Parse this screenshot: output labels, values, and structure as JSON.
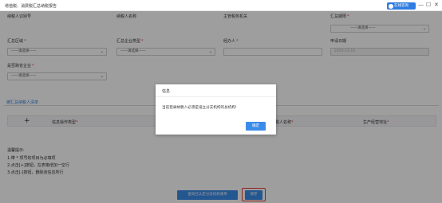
{
  "window": {
    "title": "增值税、消费税汇总纳税报告",
    "online_label": "在线咨询",
    "minimize": "—",
    "maximize": "☐",
    "close": "✕"
  },
  "form": {
    "taxpayer_id_label": "纳税人识别号",
    "taxpayer_name_label": "纳税人名称",
    "tax_authority_label": "主管税务机关",
    "summary_period_label": "汇总期限",
    "summary_period_value": "——请选择——",
    "summary_region_label": "汇总区域",
    "summary_region_value": "——请选择——",
    "enterprise_type_label": "汇总企业类型",
    "enterprise_type_value": "——请选择——",
    "handler_label": "经办人",
    "apply_date_label": "申请日期",
    "apply_date_value": "2020-12-16",
    "cross_region_label": "是否跨省企业",
    "cross_region_value": "——请选择——"
  },
  "section": {
    "title": "被汇总纳税人清单"
  },
  "table": {
    "add": "+",
    "col1": "信息操作类型",
    "col2": "纳税人名称",
    "col3": "生产经营地址"
  },
  "hints": {
    "title": "温馨提示:",
    "line1": "1.带 * 项号的项目为必填项",
    "line2": "2.点击[+]按钮，在表格增加一空行",
    "line3": "3.点击[-]按钮，删除该信息所行"
  },
  "buttons": {
    "query": "查询已认定分支机构清单",
    "save": "保存"
  },
  "dialog": {
    "title": "信息",
    "message": "当前登录纳税人必须是设立分支机构的总机构!",
    "ok": "确定"
  },
  "colors": {
    "primary": "#3b8be9",
    "required": "#e53935",
    "highlight": "#e53935"
  }
}
